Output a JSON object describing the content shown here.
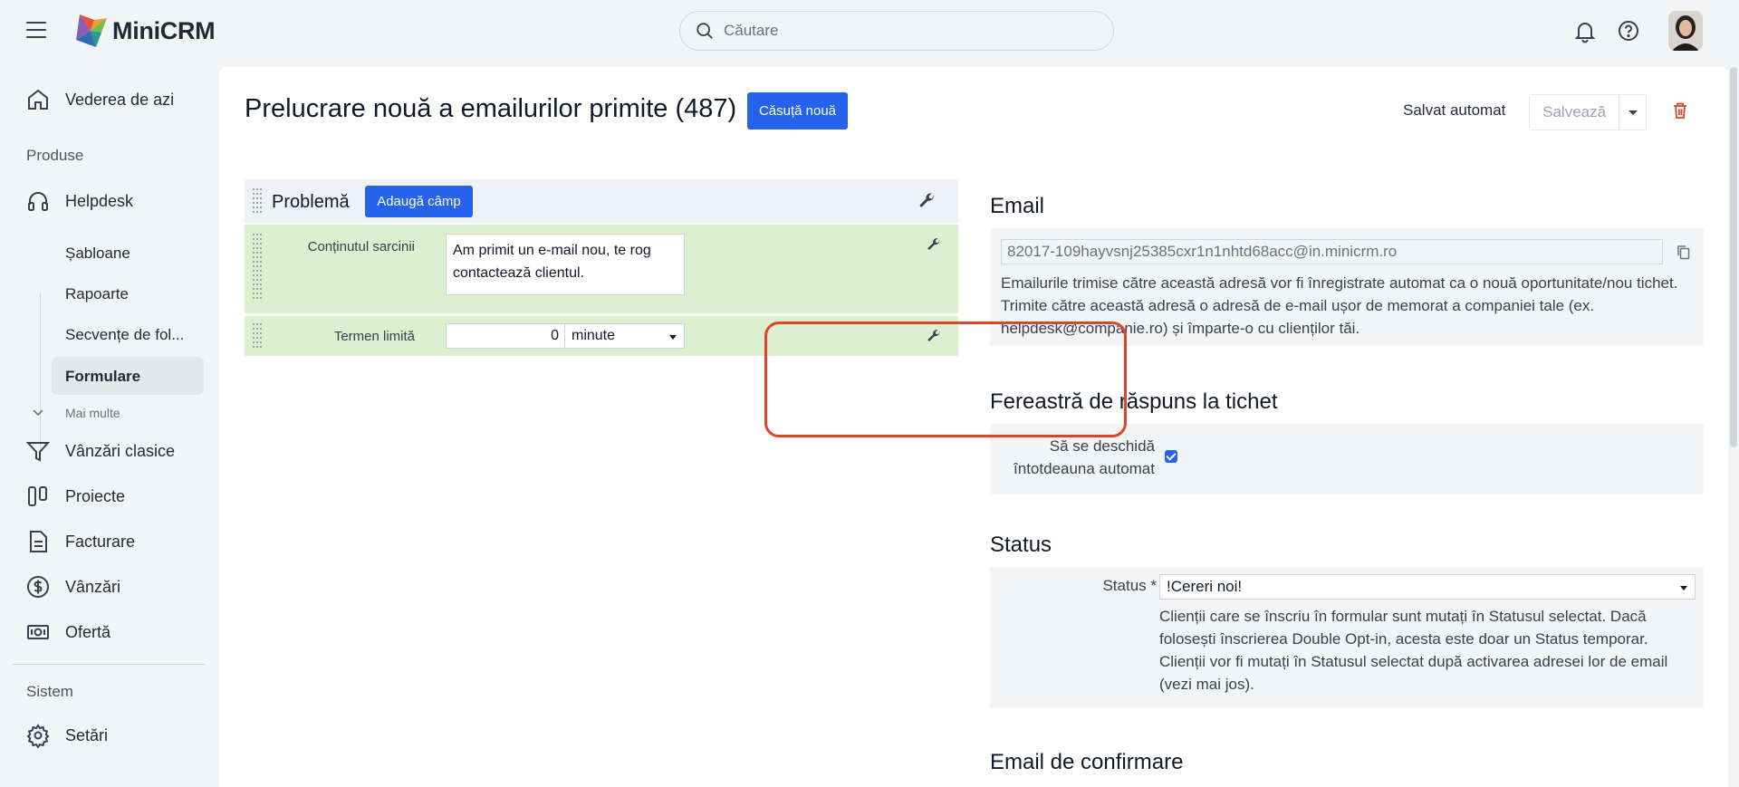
{
  "app": {
    "name": "MiniCRM"
  },
  "search": {
    "placeholder": "Căutare"
  },
  "sidebar": {
    "today": "Vederea de azi",
    "products_label": "Produse",
    "helpdesk": "Helpdesk",
    "sub_items": [
      "Șabloane",
      "Rapoarte",
      "Secvențe de fol...",
      "Formulare"
    ],
    "more": "Mai multe",
    "classic_sales": "Vânzări clasice",
    "projects": "Proiecte",
    "billing": "Facturare",
    "sales": "Vânzări",
    "offer": "Ofertă",
    "system_label": "Sistem",
    "settings": "Setări"
  },
  "header": {
    "title": "Prelucrare nouă a emailurilor primite (487)",
    "new_box": "Căsuță nouă",
    "autosave": "Salvat automat",
    "save": "Salvează"
  },
  "form": {
    "section_title": "Problemă",
    "add_field": "Adaugă câmp",
    "task_content_label": "Conținutul sarcinii",
    "task_content_value": "Am primit un e-mail nou, te rog contactează clientul.",
    "deadline_label": "Termen limită",
    "deadline_value": "0",
    "deadline_unit": "minute"
  },
  "email": {
    "title": "Email",
    "address": "82017-109hayvsnj25385cxr1n1nhtd68acc@in.minicrm.ro",
    "description": "Emailurile trimise către această adresă vor fi înregistrate automat ca o nouă oportunitate/nou tichet. Trimite către această adresă o adresă de e-mail ușor de memorat a companiei tale (ex. helpdesk@companie.ro) și împarte-o cu clienților tăi."
  },
  "ticket_window": {
    "title": "Fereastră de răspuns la tichet",
    "label_line1": "Să se deschidă",
    "label_line2": "întotdeauna automat",
    "checked": true
  },
  "status": {
    "title": "Status",
    "label": "Status *",
    "value": "!Cereri noi!",
    "description": "Clienții care se înscriu în formular sunt mutați în Statusul selectat. Dacă folosești înscrierea Double Opt-in, acesta este doar un Status temporar. Clienții vor fi mutați în Statusul selectat după activarea adresei lor de email (vezi mai jos)."
  },
  "confirmation_email": {
    "title": "Email de confirmare"
  },
  "colors": {
    "primary": "#2563eb",
    "highlight": "#e04427",
    "form_row": "#dcefcf"
  }
}
